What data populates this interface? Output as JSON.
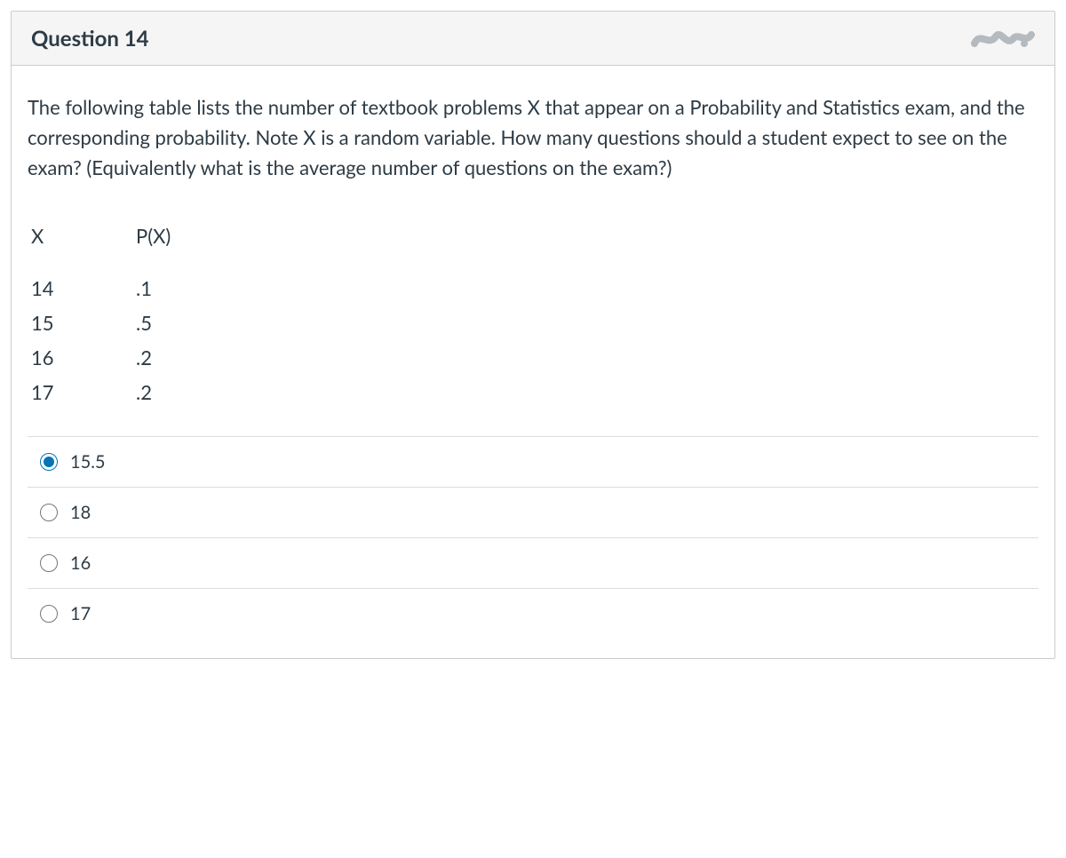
{
  "header": {
    "title": "Question 14"
  },
  "question": {
    "prompt": "The following table lists the number of textbook problems X that appear on a Probability and Statistics exam, and the corresponding probability. Note X is a random variable. How many questions should a student expect to see on the exam? (Equivalently what is the average number of questions on the exam?)"
  },
  "table": {
    "col1_header": "X",
    "col2_header": "P(X)",
    "rows": [
      {
        "x": "14",
        "p": ".1"
      },
      {
        "x": "15",
        "p": ".5"
      },
      {
        "x": "16",
        "p": ".2"
      },
      {
        "x": "17",
        "p": ".2"
      }
    ]
  },
  "answers": {
    "options": [
      {
        "label": "15.5",
        "selected": true
      },
      {
        "label": "18",
        "selected": false
      },
      {
        "label": "16",
        "selected": false
      },
      {
        "label": "17",
        "selected": false
      }
    ]
  }
}
